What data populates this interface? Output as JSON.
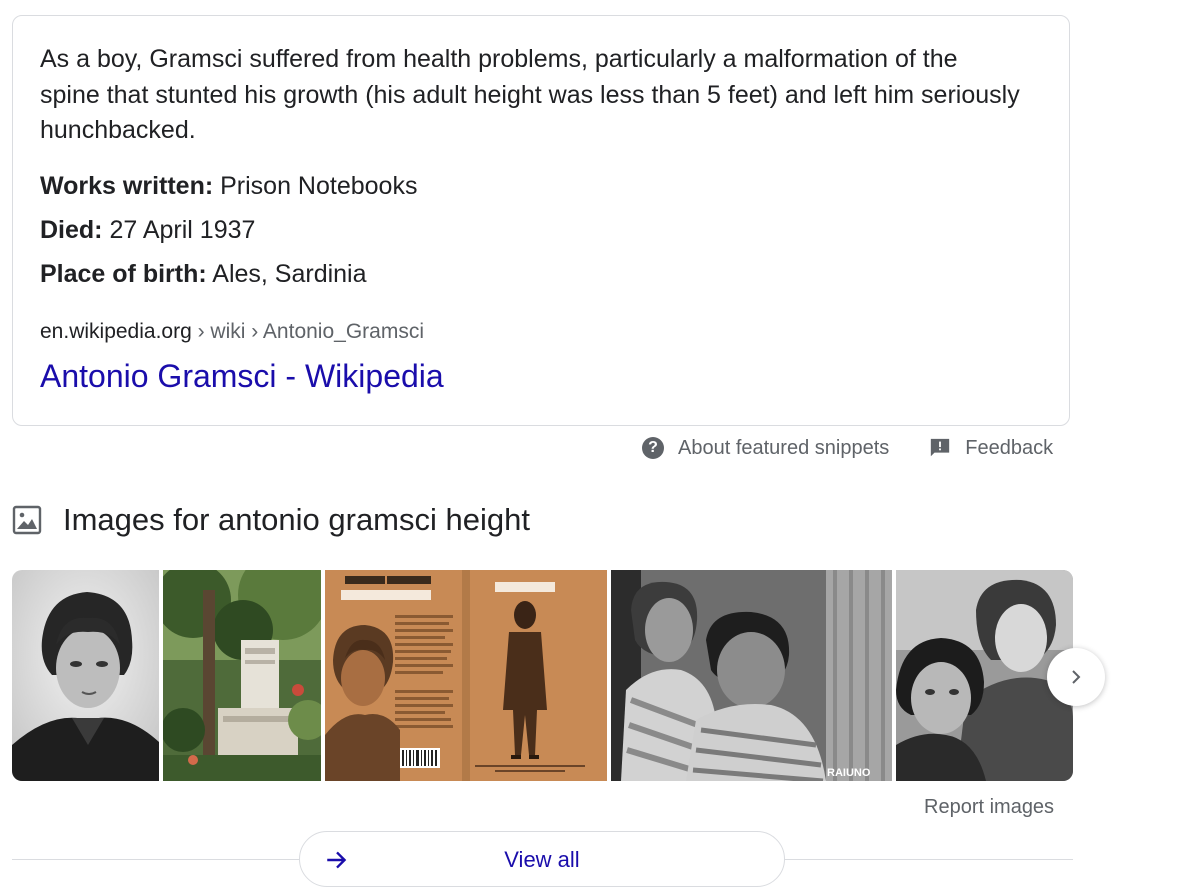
{
  "snippet": {
    "text": "As a boy, Gramsci suffered from health problems, particularly a malformation of the spine that stunted his growth (his adult height was less than 5 feet) and left him seriously hunchbacked.",
    "facts": [
      {
        "label": "Works written:",
        "value": "Prison Notebooks"
      },
      {
        "label": "Died:",
        "value": "27 April 1937"
      },
      {
        "label": "Place of birth:",
        "value": "Ales, Sardinia"
      }
    ],
    "cite_domain": "en.wikipedia.org",
    "cite_path": " › wiki › Antonio_Gramsci",
    "title": "Antonio Gramsci - Wikipedia"
  },
  "footer": {
    "about_label": "About featured snippets",
    "feedback_label": "Feedback"
  },
  "images": {
    "heading": "Images for antonio gramsci height",
    "report_label": "Report images",
    "view_all_label": "View all",
    "watermark": "RAIUNO"
  },
  "icons": {
    "image": "image-icon",
    "help": "help-circle-icon",
    "feedback": "feedback-icon",
    "next": "chevron-right-icon",
    "arrow": "arrow-right-icon"
  },
  "colors": {
    "link": "#1a0dab",
    "text": "#202124",
    "secondary": "#5f6368",
    "border": "#dadce0",
    "book_cover": "#c88a55"
  }
}
